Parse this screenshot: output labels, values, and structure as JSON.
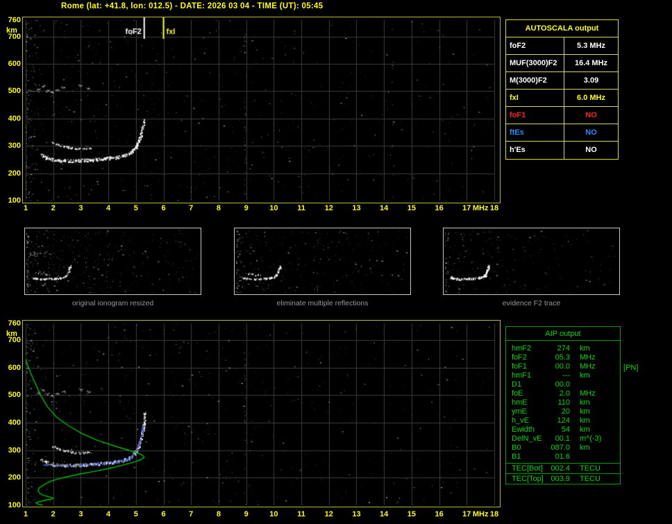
{
  "header": {
    "title": "Rome (lat: +41.8, lon: 012.5) - DATE: 2026 03 04 - TIME (UT): 05:45"
  },
  "autoscala": {
    "title": "AUTOSCALA output",
    "rows": [
      {
        "label": "foF2",
        "value": "5.3 MHz",
        "color": "#ffffff"
      },
      {
        "label": "MUF(3000)F2",
        "value": "16.4 MHz",
        "color": "#ffffff"
      },
      {
        "label": "M(3000)F2",
        "value": "3.09",
        "color": "#ffffff"
      },
      {
        "label": "fxI",
        "value": "6.0 MHz",
        "color": "#ffff00"
      },
      {
        "label": "foF1",
        "value": "NO",
        "color": "#ff2020"
      },
      {
        "label": "ftEs",
        "value": "NO",
        "color": "#1e90ff"
      },
      {
        "label": "h'Es",
        "value": "NO",
        "color": "#ffffff"
      }
    ]
  },
  "aip": {
    "title": "AIP output",
    "pn_note": "[PN]",
    "rows": [
      {
        "label": "hmF2",
        "value": "274",
        "unit": "km"
      },
      {
        "label": "foF2",
        "value": "05.3",
        "unit": "MHz"
      },
      {
        "label": "foF1",
        "value": "00.0",
        "unit": "MHz"
      },
      {
        "label": "hmF1",
        "value": "---",
        "unit": "km"
      },
      {
        "label": "D1",
        "value": "00.0",
        "unit": ""
      },
      {
        "label": "foE",
        "value": "2.0",
        "unit": "MHz"
      },
      {
        "label": "hmE",
        "value": "110",
        "unit": "km"
      },
      {
        "label": "ymE",
        "value": "20",
        "unit": "km"
      },
      {
        "label": "h_vE",
        "value": "124",
        "unit": "km"
      },
      {
        "label": "Ewidth",
        "value": "54",
        "unit": "km"
      },
      {
        "label": "DelN_vE",
        "value": "00.1",
        "unit": "m^(-3)"
      },
      {
        "label": "B0",
        "value": "087.0",
        "unit": "km"
      },
      {
        "label": "B1",
        "value": "01.6",
        "unit": ""
      }
    ],
    "tec_rows": [
      {
        "label": "TEC[Bot]",
        "value": "002.4",
        "unit": "TECU"
      },
      {
        "label": "TEC[Top]",
        "value": "003.9",
        "unit": "TECU"
      }
    ]
  },
  "thumbnails": {
    "captions": [
      "original ionogram resized",
      "eliminate multiple reflections",
      "evidence F2 trace"
    ]
  },
  "colors": {
    "accent_yellow": "#ffff00",
    "trace_white": "#ffffff",
    "profile_green": "#00c000",
    "fit_blue": "#3355e6",
    "status_red": "#ff2020",
    "status_blue": "#1e90ff",
    "grid_gray": "#3c3c3c"
  },
  "trace_sets": {
    "f2_trace": [
      [
        1.55,
        268
      ],
      [
        1.75,
        258
      ],
      [
        2.0,
        251
      ],
      [
        2.4,
        247
      ],
      [
        2.9,
        248
      ],
      [
        3.4,
        251
      ],
      [
        3.9,
        255
      ],
      [
        4.3,
        260
      ],
      [
        4.65,
        268
      ],
      [
        4.85,
        280
      ],
      [
        5.0,
        298
      ],
      [
        5.1,
        320
      ],
      [
        5.18,
        345
      ],
      [
        5.24,
        368
      ],
      [
        5.28,
        392
      ]
    ],
    "f2_trace_ext": [
      [
        1.55,
        266
      ],
      [
        1.75,
        257
      ],
      [
        2.0,
        250
      ],
      [
        2.4,
        246
      ],
      [
        2.9,
        247
      ],
      [
        3.4,
        250
      ],
      [
        3.9,
        254
      ],
      [
        4.3,
        259
      ],
      [
        4.65,
        267
      ],
      [
        4.85,
        279
      ],
      [
        5.0,
        297
      ],
      [
        5.1,
        318
      ],
      [
        5.18,
        342
      ],
      [
        5.24,
        370
      ],
      [
        5.28,
        400
      ],
      [
        5.31,
        438
      ]
    ],
    "echo_arc": [
      [
        1.95,
        316
      ],
      [
        2.2,
        305
      ],
      [
        2.55,
        296
      ],
      [
        2.95,
        291
      ],
      [
        3.35,
        294
      ]
    ],
    "high_echo": [
      [
        1.45,
        508
      ],
      [
        1.62,
        519
      ],
      [
        1.78,
        504
      ],
      [
        1.95,
        497
      ],
      [
        2.15,
        506
      ],
      [
        2.36,
        514
      ],
      [
        2.98,
        521
      ],
      [
        3.28,
        511
      ]
    ],
    "blue_fit": [
      [
        1.65,
        249
      ],
      [
        2.2,
        245
      ],
      [
        3.0,
        247
      ],
      [
        3.8,
        252
      ],
      [
        4.4,
        260
      ],
      [
        4.8,
        275
      ],
      [
        5.0,
        298
      ],
      [
        5.12,
        328
      ],
      [
        5.2,
        358
      ],
      [
        5.26,
        392
      ]
    ],
    "profile_fp": [
      [
        1.62,
        100
      ],
      [
        1.45,
        104
      ],
      [
        1.38,
        109
      ],
      [
        1.52,
        114
      ],
      [
        1.74,
        119
      ],
      [
        1.96,
        123
      ],
      [
        2.0,
        126
      ],
      [
        1.88,
        130
      ],
      [
        1.64,
        136
      ],
      [
        1.5,
        144
      ],
      [
        1.45,
        153
      ],
      [
        1.5,
        164
      ],
      [
        1.64,
        173
      ],
      [
        1.86,
        185
      ],
      [
        2.12,
        194
      ],
      [
        2.52,
        204
      ],
      [
        3.0,
        214
      ],
      [
        3.5,
        223
      ],
      [
        4.0,
        233
      ],
      [
        4.5,
        245
      ],
      [
        4.9,
        256
      ],
      [
        5.15,
        265
      ],
      [
        5.3,
        274
      ],
      [
        5.24,
        282
      ],
      [
        5.02,
        291
      ],
      [
        4.68,
        301
      ],
      [
        4.2,
        316
      ],
      [
        3.62,
        335
      ],
      [
        3.05,
        360
      ],
      [
        2.55,
        389
      ],
      [
        2.12,
        420
      ],
      [
        1.8,
        456
      ],
      [
        1.56,
        496
      ],
      [
        1.36,
        540
      ],
      [
        1.18,
        580
      ],
      [
        1.06,
        612
      ],
      [
        1.0,
        630
      ]
    ]
  },
  "chart_data": [
    {
      "id": "top-ionogram",
      "type": "scatter",
      "title": "scaled ionogram",
      "xlabel": "MHz",
      "ylabel": "km",
      "xlim": [
        1,
        18
      ],
      "ylim": [
        100,
        760
      ],
      "x_ticks": [
        1,
        2,
        3,
        4,
        5,
        6,
        7,
        8,
        9,
        10,
        11,
        12,
        13,
        14,
        15,
        16,
        17,
        18
      ],
      "y_ticks": [
        760,
        700,
        600,
        500,
        400,
        300,
        200,
        100
      ],
      "pad": {
        "l": 4,
        "r": 8,
        "t": 4,
        "b": 3
      },
      "grid": {
        "x_step": 1,
        "y_step": 100,
        "color": "#3c3c3c"
      },
      "noise": {
        "count": 680,
        "edge": 110,
        "seed": 11,
        "streaks": [
          {
            "f": 8.95,
            "count": 32
          },
          {
            "f": 14.3,
            "count": 10
          }
        ]
      },
      "traces": [
        {
          "set": "f2_trace",
          "color": "#ffffff",
          "thick": 2.2,
          "density": 4,
          "step": 2
        },
        {
          "set": "echo_arc",
          "color": "#f0f0f0",
          "thick": 1.6,
          "density": 2,
          "step": 2
        },
        {
          "set": "high_echo",
          "color": "#e0e0e0",
          "blob": true
        }
      ],
      "markers": [
        {
          "label": "foF2",
          "f": 5.3,
          "color": "#ffffff",
          "label_side": "left"
        },
        {
          "label": "fxI",
          "f": 6.0,
          "color": "#ffff00",
          "label_side": "right"
        }
      ]
    },
    {
      "id": "thumb-original",
      "type": "scatter",
      "title": "original ionogram resized",
      "xlim": [
        1,
        18
      ],
      "ylim": [
        100,
        760
      ],
      "pad": {
        "l": 2,
        "r": 2,
        "t": 2,
        "b": 2
      },
      "noise": {
        "count": 380,
        "edge": 50,
        "seed": 21,
        "streaks": [
          {
            "f": 8.95,
            "count": 12
          }
        ]
      },
      "traces": [
        {
          "set": "f2_trace",
          "color": "#ffffff",
          "thick": 1,
          "density": 2,
          "step": 2
        },
        {
          "set": "echo_arc",
          "color": "#e8e8e8",
          "thick": 1,
          "density": 1,
          "step": 2
        },
        {
          "set": "high_echo",
          "color": "#d8d8d8",
          "blob": true,
          "small": true
        }
      ]
    },
    {
      "id": "thumb-eliminate",
      "type": "scatter",
      "title": "eliminate multiple reflections",
      "xlim": [
        1,
        18
      ],
      "ylim": [
        100,
        760
      ],
      "pad": {
        "l": 2,
        "r": 2,
        "t": 2,
        "b": 2
      },
      "noise": {
        "count": 270,
        "edge": 35,
        "seed": 22,
        "streaks": [
          {
            "f": 8.95,
            "count": 8
          }
        ]
      },
      "traces": [
        {
          "set": "f2_trace",
          "color": "#ffffff",
          "thick": 1,
          "density": 2,
          "step": 2
        },
        {
          "set": "echo_arc",
          "color": "#e8e8e8",
          "thick": 1,
          "density": 1,
          "step": 2
        }
      ]
    },
    {
      "id": "thumb-evidence",
      "type": "scatter",
      "title": "evidence F2 trace",
      "xlim": [
        1,
        18
      ],
      "ylim": [
        100,
        760
      ],
      "pad": {
        "l": 2,
        "r": 2,
        "t": 2,
        "b": 2
      },
      "noise": {
        "count": 190,
        "edge": 25,
        "seed": 23,
        "streaks": []
      },
      "traces": [
        {
          "set": "f2_trace",
          "color": "#ffffff",
          "thick": 1.2,
          "density": 3,
          "step": 2
        }
      ]
    },
    {
      "id": "bottom-ionogram-profile",
      "type": "scatter",
      "title": "restored trace and electron density profile",
      "xlabel": "MHz",
      "ylabel": "km",
      "xlim": [
        1,
        18
      ],
      "ylim": [
        100,
        760
      ],
      "x_ticks": [
        1,
        2,
        3,
        4,
        5,
        6,
        7,
        8,
        9,
        10,
        11,
        12,
        13,
        14,
        15,
        16,
        17,
        18
      ],
      "y_ticks": [
        760,
        700,
        600,
        500,
        400,
        300,
        200,
        100
      ],
      "pad": {
        "l": 4,
        "r": 8,
        "t": 4,
        "b": 2
      },
      "grid": {
        "x_step": 1,
        "y_step": 100,
        "color": "#3c3c3c"
      },
      "noise": {
        "count": 620,
        "edge": 100,
        "seed": 31,
        "streaks": [
          {
            "f": 8.95,
            "count": 26
          }
        ]
      },
      "traces": [
        {
          "set": "f2_trace_ext",
          "color": "#ffffff",
          "thick": 2.2,
          "density": 3,
          "step": 2
        },
        {
          "set": "echo_arc",
          "color": "#ededed",
          "thick": 1.5,
          "density": 2,
          "step": 2
        },
        {
          "set": "high_echo",
          "color": "#dddddd",
          "blob": true
        },
        {
          "set": "blue_fit",
          "color": "#3355e6",
          "thick": 1.2,
          "density": 2,
          "step": 2
        }
      ],
      "profile": {
        "set": "profile_fp",
        "color": "#00c000",
        "width": 1.4
      }
    }
  ]
}
